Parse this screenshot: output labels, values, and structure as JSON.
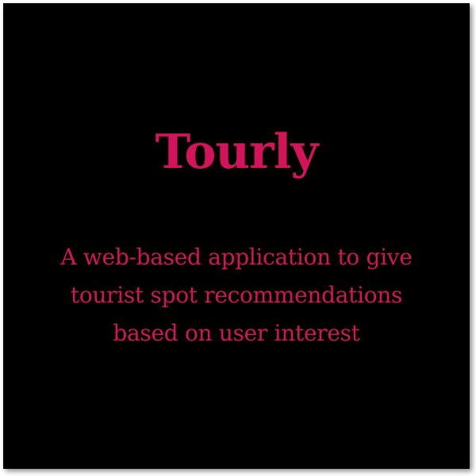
{
  "colors": {
    "background": "#000000",
    "accent": "#d4145a"
  },
  "card": {
    "title": "Tourly",
    "subtitle_lines": [
      "A web-based application to give",
      "tourist spot recommendations",
      "based on user interest"
    ]
  }
}
